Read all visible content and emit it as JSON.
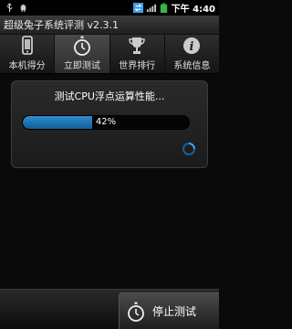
{
  "status_bar": {
    "time": "下午 4:40",
    "icons": [
      "usb-icon",
      "android-icon",
      "sync-icon",
      "signal-icon",
      "battery-icon"
    ]
  },
  "app": {
    "title": "超级兔子系统评测 v2.3.1"
  },
  "tabs": [
    {
      "label": "本机得分",
      "icon": "phone-icon",
      "active": false
    },
    {
      "label": "立即测试",
      "icon": "stopwatch-icon",
      "active": true
    },
    {
      "label": "世界排行",
      "icon": "trophy-icon",
      "active": false
    },
    {
      "label": "系统信息",
      "icon": "info-icon",
      "active": false
    }
  ],
  "test_panel": {
    "title": "测试CPU浮点运算性能...",
    "progress_percent": 42,
    "progress_text": "42%"
  },
  "bottom": {
    "stop_label": "停止测试"
  },
  "colors": {
    "accent": "#2f8cd0",
    "background": "#0a0a0a"
  }
}
